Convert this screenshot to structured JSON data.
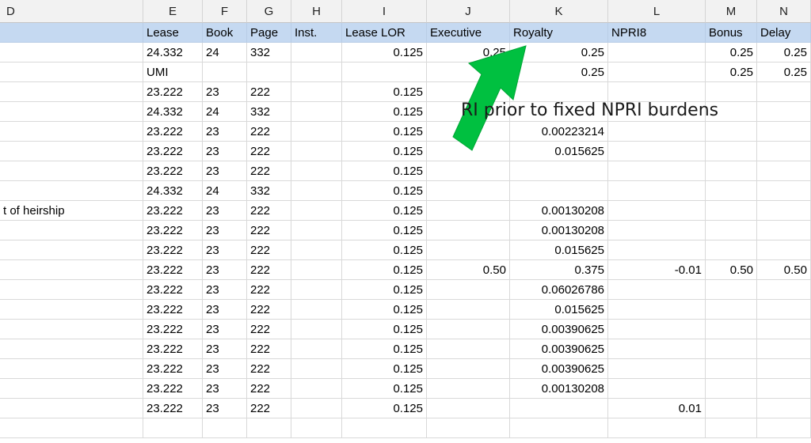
{
  "columns": [
    "D",
    "E",
    "F",
    "G",
    "H",
    "I",
    "J",
    "K",
    "L",
    "M",
    "N"
  ],
  "labels": [
    "",
    "Lease",
    "Book",
    "Page",
    "Inst.",
    "Lease LOR",
    "Executive",
    "Royalty",
    "NPRI8",
    "Bonus",
    "Delay"
  ],
  "rows": [
    [
      "",
      "24.332",
      "24",
      "332",
      "",
      "0.125",
      "0.25",
      "0.25",
      "",
      "0.25",
      "0.25"
    ],
    [
      "",
      "UMI",
      "",
      "",
      "",
      "",
      "0",
      "0.25",
      "",
      "0.25",
      "0.25"
    ],
    [
      "",
      "23.222",
      "23",
      "222",
      "",
      "0.125",
      "",
      "",
      "",
      "",
      ""
    ],
    [
      "",
      "24.332",
      "24",
      "332",
      "",
      "0.125",
      "",
      "",
      "",
      "",
      ""
    ],
    [
      "",
      "23.222",
      "23",
      "222",
      "",
      "0.125",
      "",
      "0.00223214",
      "",
      "",
      ""
    ],
    [
      "",
      "23.222",
      "23",
      "222",
      "",
      "0.125",
      "",
      "0.015625",
      "",
      "",
      ""
    ],
    [
      "",
      "23.222",
      "23",
      "222",
      "",
      "0.125",
      "",
      "",
      "",
      "",
      ""
    ],
    [
      "",
      "24.332",
      "24",
      "332",
      "",
      "0.125",
      "",
      "",
      "",
      "",
      ""
    ],
    [
      "t of heirship",
      "23.222",
      "23",
      "222",
      "",
      "0.125",
      "",
      "0.00130208",
      "",
      "",
      ""
    ],
    [
      "",
      "23.222",
      "23",
      "222",
      "",
      "0.125",
      "",
      "0.00130208",
      "",
      "",
      ""
    ],
    [
      "",
      "23.222",
      "23",
      "222",
      "",
      "0.125",
      "",
      "0.015625",
      "",
      "",
      ""
    ],
    [
      "",
      "23.222",
      "23",
      "222",
      "",
      "0.125",
      "0.50",
      "0.375",
      "-0.01",
      "0.50",
      "0.50"
    ],
    [
      "",
      "23.222",
      "23",
      "222",
      "",
      "0.125",
      "",
      "0.06026786",
      "",
      "",
      ""
    ],
    [
      "",
      "23.222",
      "23",
      "222",
      "",
      "0.125",
      "",
      "0.015625",
      "",
      "",
      ""
    ],
    [
      "",
      "23.222",
      "23",
      "222",
      "",
      "0.125",
      "",
      "0.00390625",
      "",
      "",
      ""
    ],
    [
      "",
      "23.222",
      "23",
      "222",
      "",
      "0.125",
      "",
      "0.00390625",
      "",
      "",
      ""
    ],
    [
      "",
      "23.222",
      "23",
      "222",
      "",
      "0.125",
      "",
      "0.00390625",
      "",
      "",
      ""
    ],
    [
      "",
      "23.222",
      "23",
      "222",
      "",
      "0.125",
      "",
      "0.00130208",
      "",
      "",
      ""
    ],
    [
      "",
      "23.222",
      "23",
      "222",
      "",
      "0.125",
      "",
      "",
      "0.01",
      "",
      ""
    ],
    [
      "",
      "",
      "",
      "",
      "",
      "",
      "",
      "",
      "",
      "",
      ""
    ]
  ],
  "annotation": {
    "text": "RI prior to fixed NPRI burdens",
    "arrow_color": "#00c040"
  }
}
